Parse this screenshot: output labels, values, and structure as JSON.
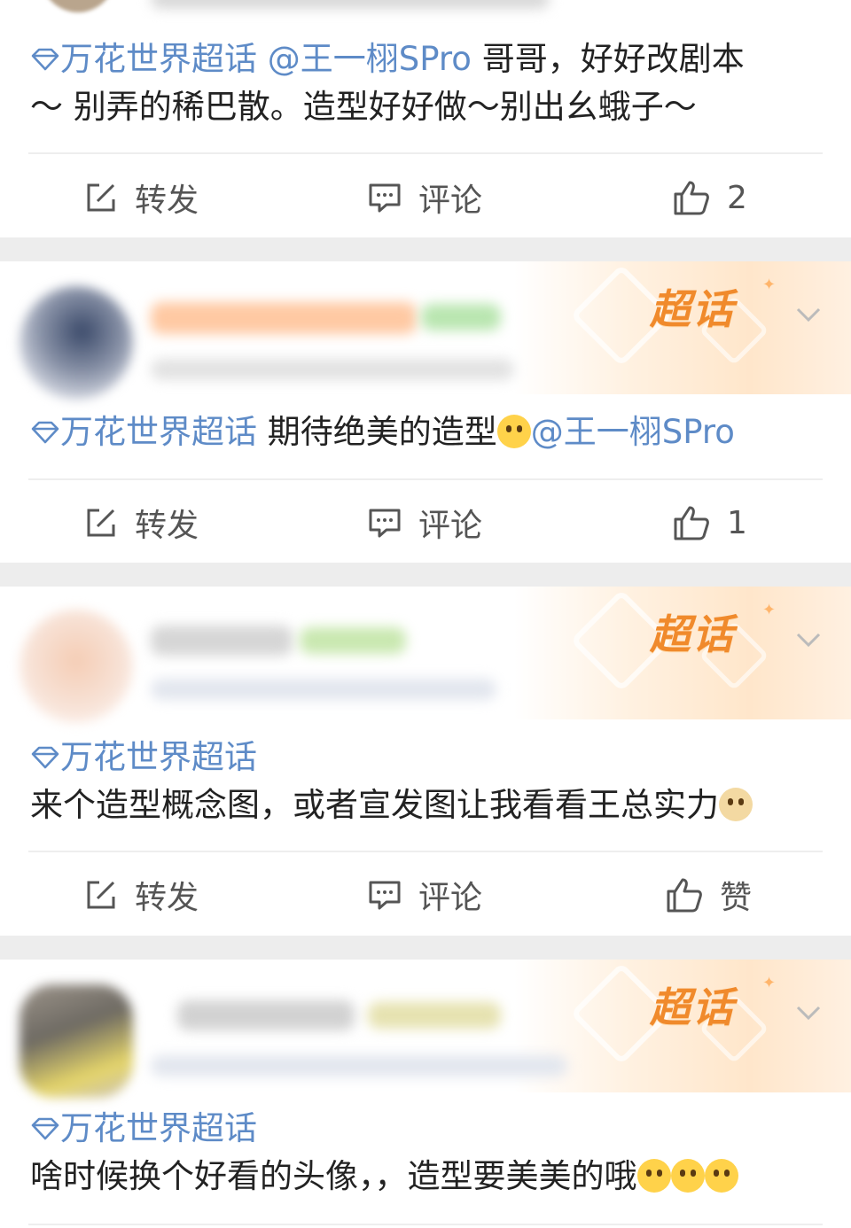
{
  "posts": [
    {
      "tag": "万花世界超话",
      "line1_mention": "@王一栩SPro",
      "line1_text": " 哥哥，好好改剧本",
      "line2_text": "～ 别弄的稀巴散。造型好好做～别出幺蛾子～",
      "actions": {
        "repost": "转发",
        "comment": "评论",
        "like": "2"
      }
    },
    {
      "header_badge": "超话",
      "tag": "万花世界超话",
      "text": " 期待绝美的造型",
      "mention": "@王一栩SPro",
      "actions": {
        "repost": "转发",
        "comment": "评论",
        "like": "1"
      }
    },
    {
      "header_badge": "超话",
      "tag": "万花世界超话",
      "text": "来个造型概念图，或者宣发图让我看看王总实力",
      "actions": {
        "repost": "转发",
        "comment": "评论",
        "like": "赞"
      }
    },
    {
      "header_badge": "超话",
      "tag": "万花世界超话",
      "text": "啥时候换个好看的头像，，造型要美美的哦"
    }
  ],
  "colors": {
    "tag": "#5e8bc7",
    "badge": "#f08a2c",
    "icon": "#555555",
    "separator": "#ededed"
  },
  "icons": {
    "repost": "edit-square-icon",
    "comment": "comment-bubble-icon",
    "like": "thumbs-up-icon",
    "tag": "diamond-icon",
    "menu": "chevron-down-icon"
  }
}
